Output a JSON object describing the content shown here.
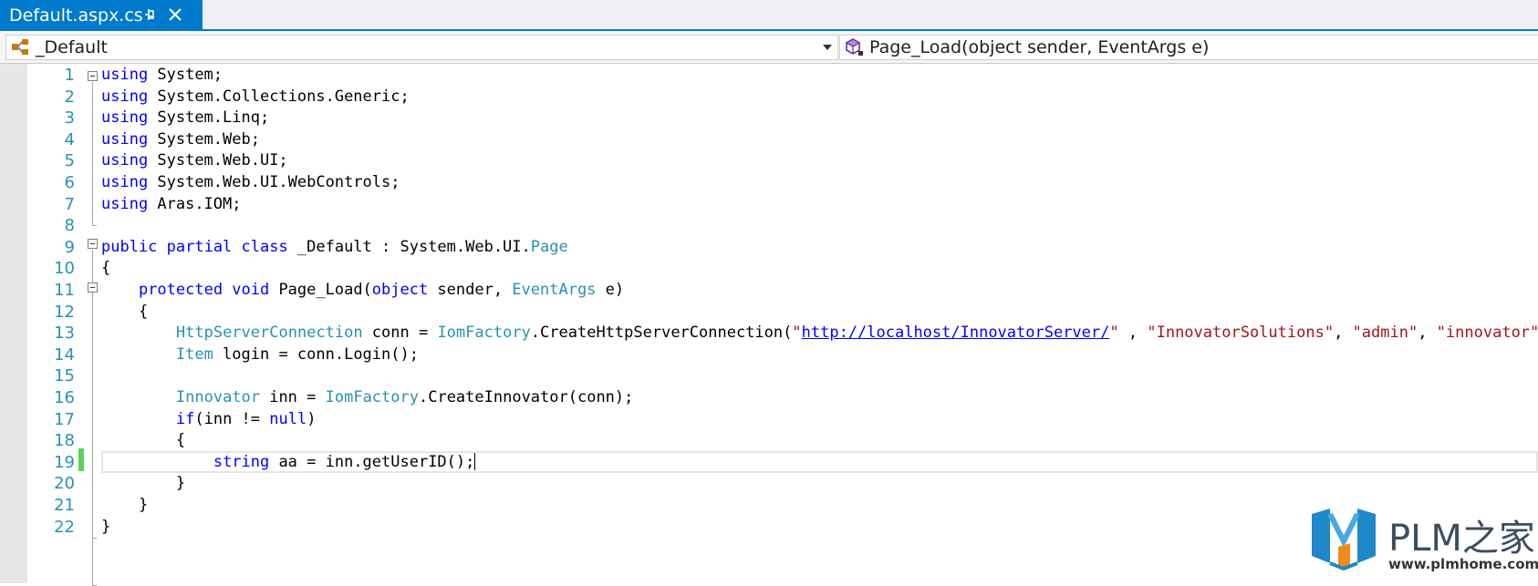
{
  "tab": {
    "title": "Default.aspx.cs"
  },
  "navbar": {
    "class_combo": "_Default",
    "member_combo": "Page_Load(object sender, EventArgs e)"
  },
  "watermark": {
    "brand": "PLM之家",
    "url": "www.plmhome.com"
  },
  "editor": {
    "current_line": 19,
    "lines": [
      {
        "n": "1",
        "tokens": [
          [
            "kw",
            "using"
          ],
          [
            "",
            "System;"
          ]
        ]
      },
      {
        "n": "2",
        "tokens": [
          [
            "kw",
            "using"
          ],
          [
            "",
            "System.Collections.Generic;"
          ]
        ]
      },
      {
        "n": "3",
        "tokens": [
          [
            "kw",
            "using"
          ],
          [
            "",
            "System.Linq;"
          ]
        ]
      },
      {
        "n": "4",
        "tokens": [
          [
            "kw",
            "using"
          ],
          [
            "",
            "System.Web;"
          ]
        ]
      },
      {
        "n": "5",
        "tokens": [
          [
            "kw",
            "using"
          ],
          [
            "",
            "System.Web.UI;"
          ]
        ]
      },
      {
        "n": "6",
        "tokens": [
          [
            "kw",
            "using"
          ],
          [
            "",
            "System.Web.UI.WebControls;"
          ]
        ]
      },
      {
        "n": "7",
        "tokens": [
          [
            "kw",
            "using"
          ],
          [
            "",
            "Aras.IOM;"
          ]
        ]
      },
      {
        "n": "8",
        "tokens": []
      },
      {
        "n": "9",
        "tokens": [
          [
            "kw",
            "public partial class"
          ],
          [
            "",
            "_Default : System.Web.UI."
          ],
          [
            "ty",
            "Page"
          ]
        ]
      },
      {
        "n": "10",
        "tokens": [
          [
            "",
            "{"
          ]
        ]
      },
      {
        "n": "11",
        "tokens": [
          [
            "",
            "    "
          ],
          [
            "kw",
            "protected void"
          ],
          [
            "",
            "Page_Load("
          ],
          [
            "kw",
            "object"
          ],
          [
            "",
            "sender, "
          ],
          [
            "ty",
            "EventArgs"
          ],
          [
            "",
            "e)"
          ]
        ]
      },
      {
        "n": "12",
        "tokens": [
          [
            "",
            "    {"
          ]
        ]
      },
      {
        "n": "13",
        "tokens": [
          [
            "",
            "        "
          ],
          [
            "ty",
            "HttpServerConnection"
          ],
          [
            "",
            "conn = "
          ],
          [
            "ty",
            "IomFactory"
          ],
          [
            "",
            ".CreateHttpServerConnection("
          ],
          [
            "str",
            "\""
          ],
          [
            "url",
            "http://localhost/InnovatorServer/"
          ],
          [
            "str",
            "\""
          ],
          [
            "",
            " , "
          ],
          [
            "str",
            "\"InnovatorSolutions\""
          ],
          [
            "",
            ", "
          ],
          [
            "str",
            "\"admin\""
          ],
          [
            "",
            ", "
          ],
          [
            "str",
            "\"innovator\""
          ],
          [
            "",
            ");"
          ]
        ]
      },
      {
        "n": "14",
        "tokens": [
          [
            "",
            "        "
          ],
          [
            "ty",
            "Item"
          ],
          [
            "",
            "login = conn.Login();"
          ]
        ]
      },
      {
        "n": "15",
        "tokens": []
      },
      {
        "n": "16",
        "tokens": [
          [
            "",
            "        "
          ],
          [
            "ty",
            "Innovator"
          ],
          [
            "",
            "inn = "
          ],
          [
            "ty",
            "IomFactory"
          ],
          [
            "",
            ".CreateInnovator(conn);"
          ]
        ]
      },
      {
        "n": "17",
        "tokens": [
          [
            "",
            "        "
          ],
          [
            "kw",
            "if"
          ],
          [
            "",
            "(inn != "
          ],
          [
            "kw",
            "null"
          ],
          [
            "",
            ")"
          ]
        ]
      },
      {
        "n": "18",
        "tokens": [
          [
            "",
            "        {"
          ]
        ]
      },
      {
        "n": "19",
        "tokens": [
          [
            "",
            "            "
          ],
          [
            "kw",
            "string"
          ],
          [
            "",
            "aa = inn.getUserID();"
          ]
        ]
      },
      {
        "n": "20",
        "tokens": [
          [
            "",
            "        }"
          ]
        ]
      },
      {
        "n": "21",
        "tokens": [
          [
            "",
            "    }"
          ]
        ]
      },
      {
        "n": "22",
        "tokens": [
          [
            "",
            "}"
          ]
        ]
      }
    ]
  }
}
